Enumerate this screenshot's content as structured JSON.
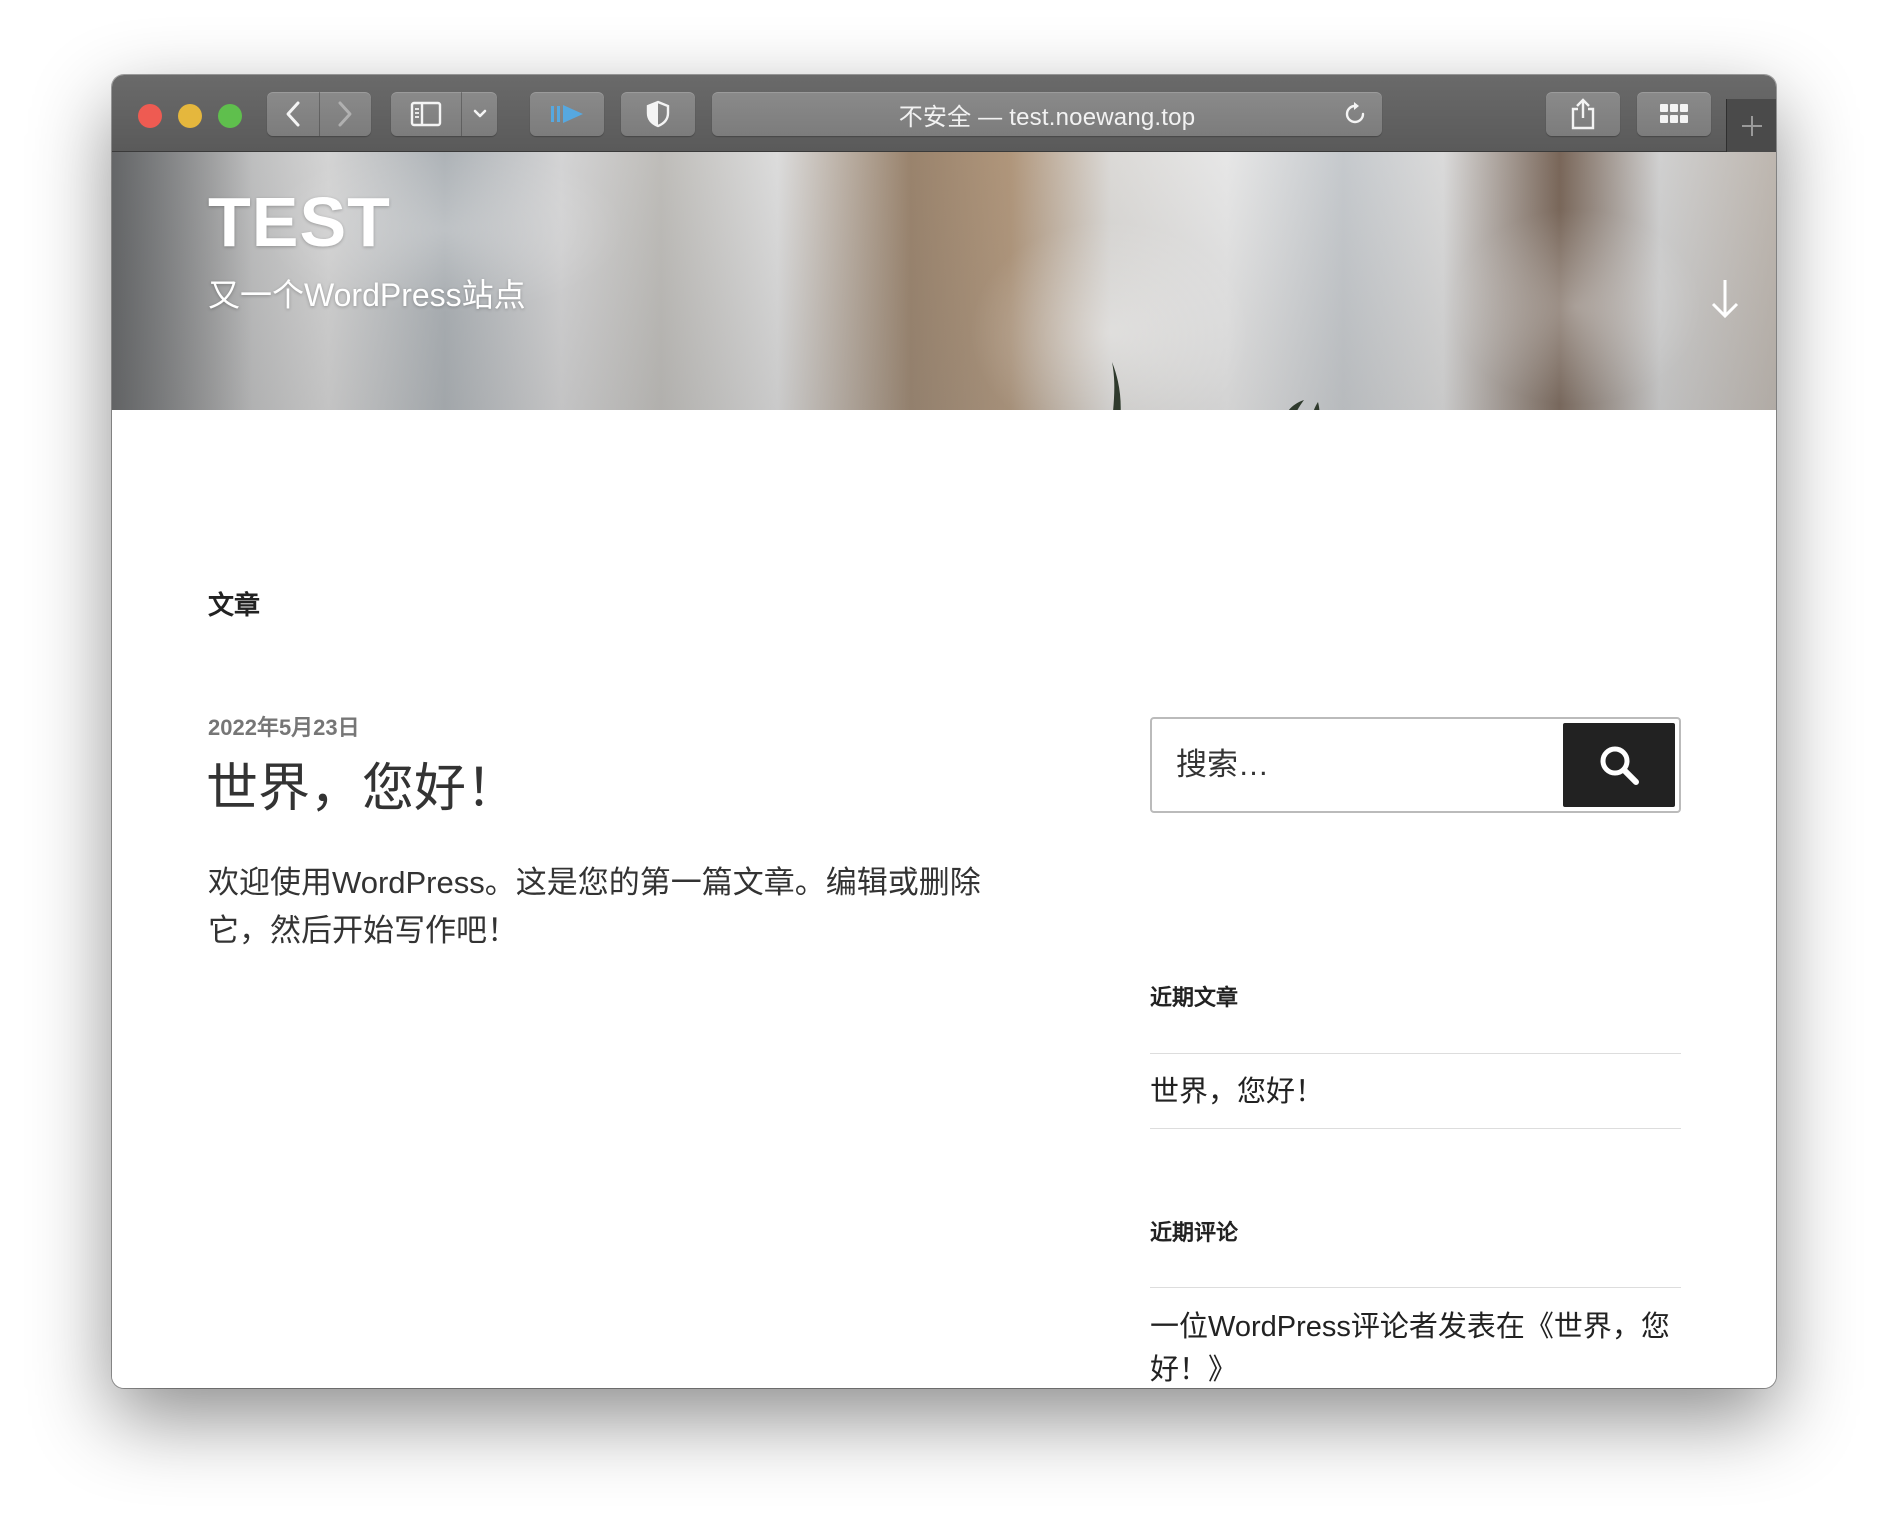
{
  "browser": {
    "address_text": "不安全 — test.noewang.top",
    "icons": {
      "back": "chevron-left-icon",
      "forward": "chevron-right-icon",
      "sidebar": "sidebar-icon",
      "sidebar_menu": "chevron-down-icon",
      "media": "media-play-icon",
      "privacy": "shield-icon",
      "reload": "reload-icon",
      "share": "share-icon",
      "tabs": "grid-icon",
      "new_tab": "plus-icon"
    },
    "colors": {
      "close": "#ee5b52",
      "minimize": "#e5b73d",
      "zoom": "#5fbf4d",
      "media_accent": "#56a8e0"
    }
  },
  "header": {
    "site_title": "TEST",
    "site_description": "又一个WordPress站点",
    "scroll_icon": "arrow-down-icon"
  },
  "main": {
    "page_heading": "文章",
    "post": {
      "date": "2022年5月23日",
      "title": "世界，您好！",
      "excerpt": "欢迎使用WordPress。这是您的第一篇文章。编辑或删除它，然后开始写作吧！"
    }
  },
  "sidebar": {
    "search": {
      "placeholder": "搜索…",
      "button_icon": "search-icon",
      "button_color": "#222222"
    },
    "recent_posts": {
      "title": "近期文章",
      "items": [
        "世界，您好！"
      ]
    },
    "recent_comments": {
      "title": "近期评论",
      "items": [
        "一位WordPress评论者发表在《世界，您好！》"
      ]
    }
  }
}
